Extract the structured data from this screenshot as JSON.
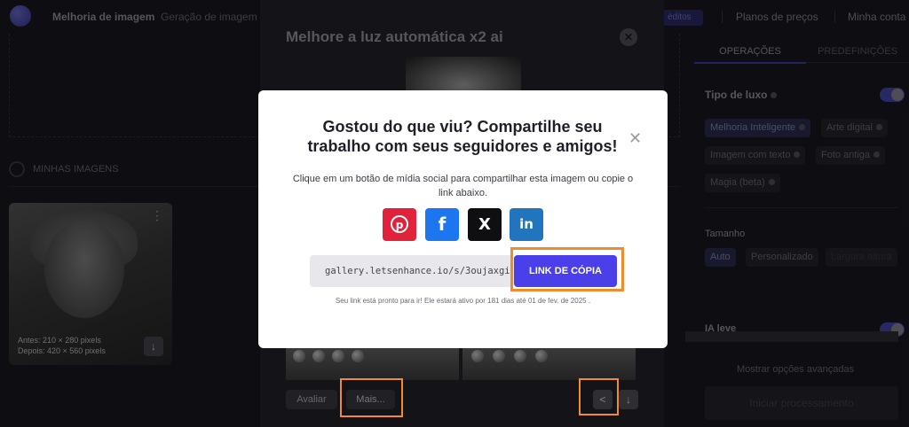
{
  "header": {
    "nav_items": [
      "Melhoria de imagem",
      "Geração de imagem"
    ],
    "credits_label": "éditos",
    "right_links": [
      "Planos de preços",
      "Minha conta"
    ]
  },
  "left": {
    "my_images_label": "MINHAS IMAGENS",
    "thumbnail": {
      "before": "Antes:  210 × 280 pixels",
      "after": "Depois: 420 × 560 pixels"
    }
  },
  "editor": {
    "title": "Melhore a luz automática x2 ai",
    "avaliar_label": "Avaliar",
    "mais_label": "Mais..."
  },
  "right_panel": {
    "tabs": [
      "OPERAÇÕES",
      "PREDEFINIÇÕES"
    ],
    "tipo_label": "Tipo de luxo",
    "types": [
      "Melhoria Inteligente",
      "Arte digital",
      "Imagem com texto",
      "Foto antiga",
      "Magia (beta)"
    ],
    "selected_type": "Melhoria Inteligente",
    "tamanho_label": "Tamanho",
    "sizes": [
      "Auto",
      "Personalizado",
      "Largura altura"
    ],
    "ia_label": "IA leve",
    "mostrar_label": "Mostrar opções avançadas",
    "iniciar_label": "Iniciar processamento"
  },
  "modal": {
    "title": "Gostou do que viu? Compartilhe seu trabalho com seus seguidores e amigos!",
    "description": "Clique em um botão de mídia social para compartilhar esta imagem ou copie o link abaixo.",
    "social_icons": [
      "pinterest-icon",
      "facebook-icon",
      "x-icon",
      "linkedin-icon"
    ],
    "link_value": "gallery.letsenhance.io/s/3oujaxgi",
    "copy_label": "LINK DE CÓPIA",
    "note": "Seu link está pronto para ir! Ele estará ativo por 181 dias até 01 de fev. de 2025 ."
  },
  "colors": {
    "accent": "#4a3fe8",
    "highlight": "#f08c2e",
    "pinterest": "#e0223a",
    "facebook": "#1c76f0",
    "linkedin": "#2175bd"
  }
}
